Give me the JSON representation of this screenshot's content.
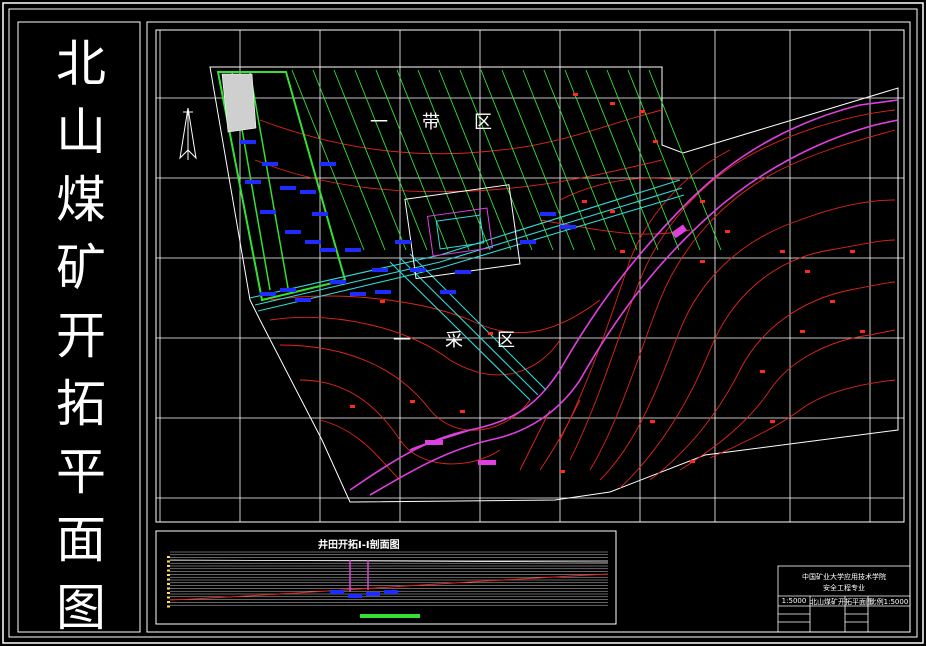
{
  "drawing": {
    "title": "北山煤矿开拓平面图",
    "zone_upper": "一带区",
    "zone_lower": "一采区",
    "section_title": "井田开拓I-I剖面图"
  },
  "title_block": {
    "institution": "中国矿业大学应用技术学院",
    "department": "安全工程专业",
    "drawing_name": "北山煤矿开拓平面图",
    "scale": "比例1:5000",
    "scale_left": "1:5000"
  },
  "colors": {
    "background": "#000000",
    "frame": "#ffffff",
    "grid": "#ffffff",
    "contour": "#e0261c",
    "river": "#e040e0",
    "roadway": "#33d6d6",
    "panel": "#33e033",
    "workings": "#1f2cff"
  }
}
